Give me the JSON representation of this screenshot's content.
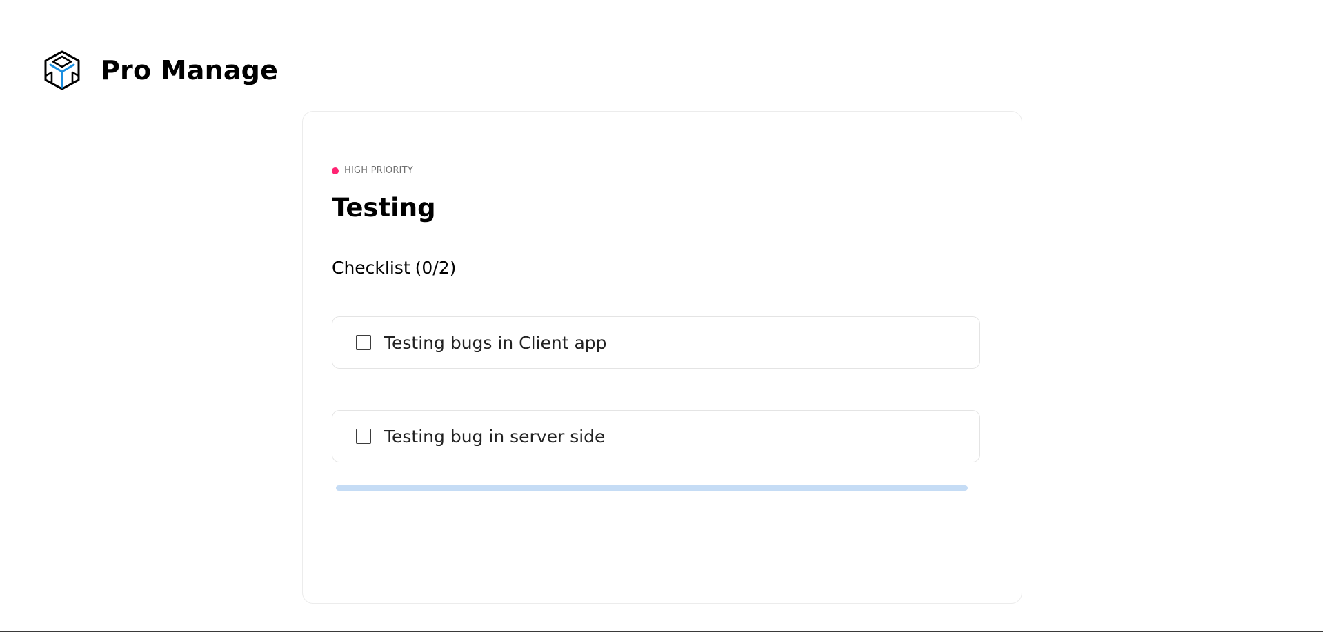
{
  "app": {
    "name": "Pro Manage",
    "logo_icon": "cube-icon",
    "accent_color": "#1a8ee0"
  },
  "task": {
    "priority": {
      "label": "HIGH PRIORITY",
      "color": "#ff2473"
    },
    "title": "Testing",
    "checklist": {
      "label": "Checklist",
      "count": "(0/2)",
      "items": [
        {
          "text": "Testing bugs in Client app",
          "checked": false
        },
        {
          "text": "Testing bug in server side",
          "checked": false
        }
      ]
    },
    "progress": {
      "value": 0
    }
  }
}
